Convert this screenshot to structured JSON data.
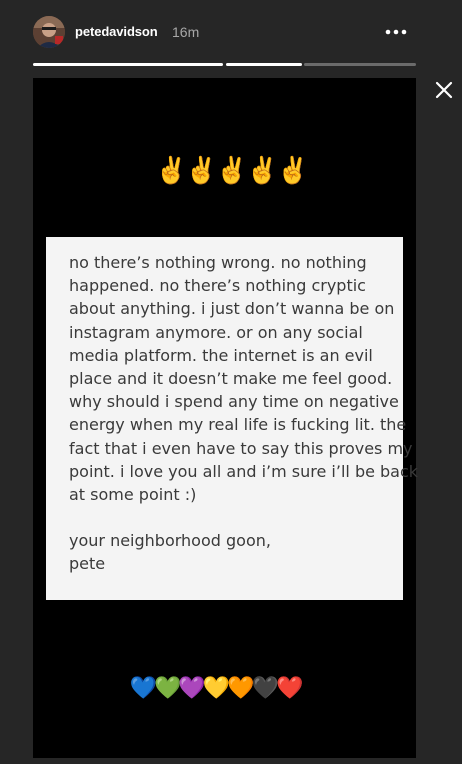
{
  "header": {
    "username": "petedavidson",
    "time_ago": "16m",
    "avatar_alt": "petedavidson avatar"
  },
  "progress": {
    "segments": 3,
    "current_index": 1,
    "current_fill": 1.0
  },
  "story": {
    "top_emoji": "✌️✌️✌️✌️✌️",
    "note_lines": [
      "no there’s nothing wrong. no nothing",
      "happened. no there’s nothing cryptic",
      "about anything. i just don’t wanna be on",
      "instagram anymore. or on any social",
      "media platform. the internet is an evil",
      "place and it doesn’t make me feel good.",
      "why should i spend any time on negative",
      "energy when my real life is fucking lit. the",
      "fact that i even have to say this proves my",
      "point. i love you all and i’m sure i’ll be back",
      "at some point :)"
    ],
    "signoff_lines": [
      "your neighborhood goon,",
      "pete"
    ],
    "bottom_emoji": "💙💚💜💛🧡🖤❤️"
  },
  "colors": {
    "background": "#262626",
    "story_background": "#000000",
    "note_background": "#f4f4f4",
    "note_text": "#3a3a3a",
    "progress_done": "#ffffff",
    "progress_remaining": "#6b6b6b"
  },
  "icons": {
    "more": "more-dots-icon",
    "close": "close-icon"
  }
}
